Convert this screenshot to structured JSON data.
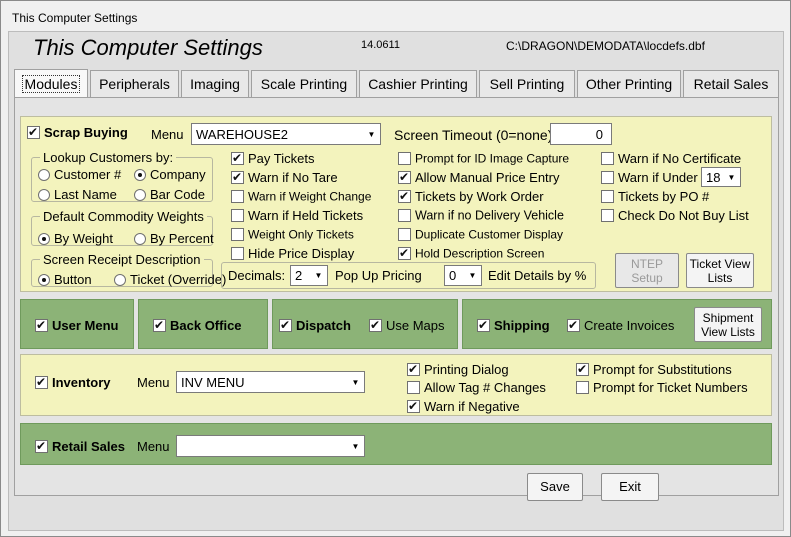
{
  "window": {
    "title": "This Computer Settings"
  },
  "header": {
    "title": "This Computer Settings",
    "version": "14.0611",
    "path": "C:\\DRAGON\\DEMODATA\\locdefs.dbf"
  },
  "tabs": [
    "Modules",
    "Peripherals",
    "Imaging",
    "Scale Printing",
    "Cashier Printing",
    "Sell Printing",
    "Other Printing",
    "Retail Sales"
  ],
  "scrap": {
    "label": "Scrap Buying",
    "menu_label": "Menu",
    "menu_value": "WAREHOUSE2",
    "timeout_label": "Screen Timeout (0=none)",
    "timeout_value": "0",
    "lookup": {
      "legend": "Lookup Customers by:",
      "opt1": "Customer #",
      "opt2": "Company",
      "opt3": "Last Name",
      "opt4": "Bar Code"
    },
    "weights": {
      "legend": "Default Commodity Weights",
      "opt1": "By Weight",
      "opt2": "By Percent"
    },
    "receipt": {
      "legend": "Screen Receipt Description",
      "opt1": "Button",
      "opt2": "Ticket (Override)"
    },
    "col1": [
      "Pay Tickets",
      "Warn if No Tare",
      "Warn if Weight Change",
      "Warn if Held Tickets",
      "Weight Only Tickets",
      "Hide Price Display"
    ],
    "col2": [
      "Prompt for ID Image Capture",
      "Allow Manual Price Entry",
      "Tickets by Work Order",
      "Warn if no Delivery Vehicle",
      "Duplicate Customer Display",
      "Hold Description Screen"
    ],
    "col3": [
      "Warn if No Certificate",
      "Warn if Under",
      "Tickets by PO #",
      "Check Do Not Buy List"
    ],
    "under_value": "18",
    "decimals_label": "Decimals:",
    "decimals_value": "2",
    "popup_label": "Pop Up Pricing",
    "popup_value": "0",
    "edit_label": "Edit Details by %",
    "ntep_label": "NTEP Setup",
    "ticket_view_label": "Ticket View Lists"
  },
  "green_row": {
    "user_menu": "User Menu",
    "back_office": "Back Office",
    "dispatch": "Dispatch",
    "use_maps": "Use Maps",
    "shipping": "Shipping",
    "create_invoices": "Create Invoices",
    "shipment_view_label": "Shipment View Lists"
  },
  "inventory": {
    "label": "Inventory",
    "menu_label": "Menu",
    "menu_value": "INV MENU",
    "opts": [
      "Printing Dialog",
      "Allow Tag # Changes",
      "Warn if Negative"
    ],
    "opts2": [
      "Prompt for Substitutions",
      "Prompt for Ticket Numbers"
    ]
  },
  "retail": {
    "label": "Retail Sales",
    "menu_label": "Menu",
    "menu_value": ""
  },
  "buttons": {
    "save": "Save",
    "exit": "Exit"
  }
}
